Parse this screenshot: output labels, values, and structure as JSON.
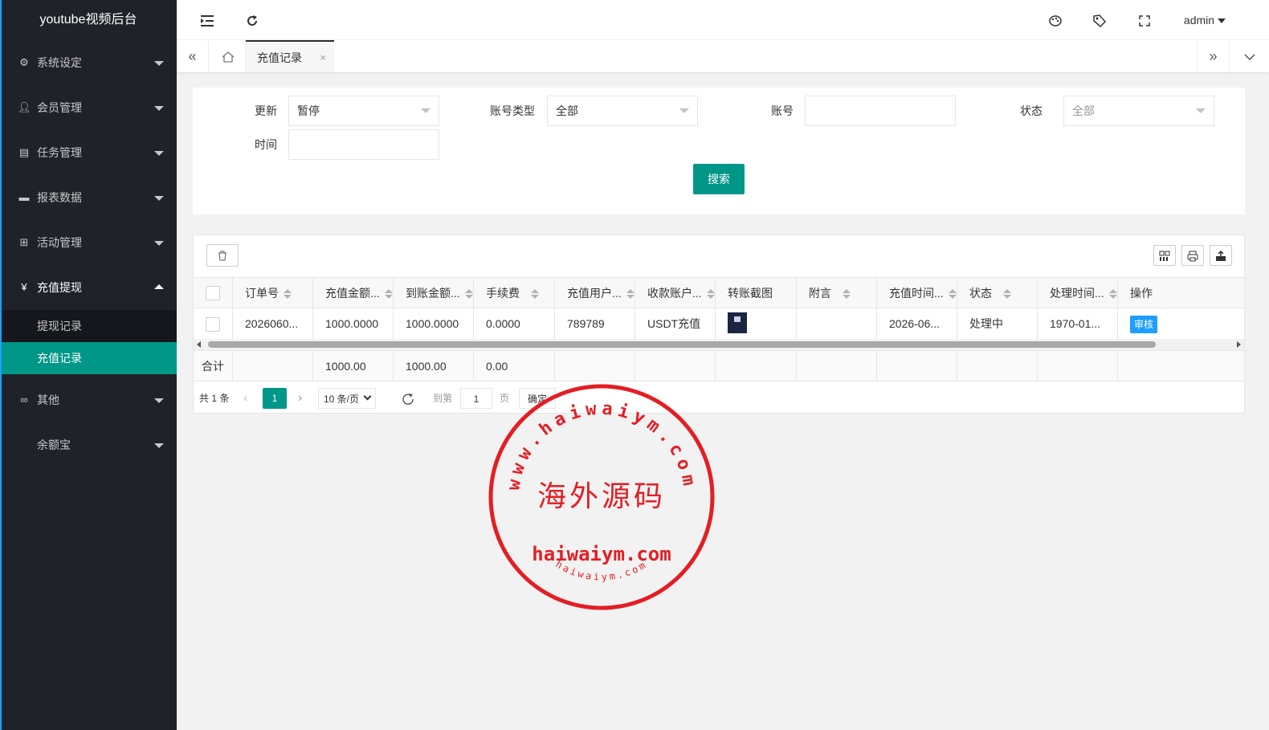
{
  "app": {
    "title": "youtube视频后台"
  },
  "colors": {
    "sidebar_bg": "#20222a",
    "accent": "#009688",
    "info": "#1e9fff",
    "stamp": "#e31e24"
  },
  "sidebar": {
    "items": [
      {
        "label": "系统设定",
        "icon": "gear-icon",
        "open": false
      },
      {
        "label": "会员管理",
        "icon": "user-icon",
        "open": false
      },
      {
        "label": "任务管理",
        "icon": "task-icon",
        "open": false
      },
      {
        "label": "报表数据",
        "icon": "report-icon",
        "open": false
      },
      {
        "label": "活动管理",
        "icon": "activity-icon",
        "open": false
      },
      {
        "label": "充值提现",
        "icon": "yen-icon",
        "open": true,
        "children": [
          {
            "label": "提现记录",
            "active": false
          },
          {
            "label": "充值记录",
            "active": true
          }
        ]
      },
      {
        "label": "其他",
        "icon": "link-icon",
        "open": false
      },
      {
        "label": "余额宝",
        "icon": "",
        "open": false
      }
    ]
  },
  "header": {
    "user": "admin",
    "icons": [
      "menu-fold-icon",
      "refresh-icon",
      "theme-icon",
      "tag-icon",
      "fullscreen-icon"
    ]
  },
  "tabs": {
    "active": "充值记录",
    "close": "×"
  },
  "search": {
    "fields": {
      "update": {
        "label": "更新",
        "value": "暂停"
      },
      "account_type": {
        "label": "账号类型",
        "value": "全部"
      },
      "account": {
        "label": "账号",
        "value": ""
      },
      "status": {
        "label": "状态",
        "placeholder": "全部"
      },
      "time": {
        "label": "时间",
        "value": ""
      }
    },
    "button": "搜索"
  },
  "table": {
    "columns": [
      "订单号",
      "充值金额...",
      "到账金额...",
      "手续费",
      "充值用户...",
      "收款账户...",
      "转账截图",
      "附言",
      "充值时间...",
      "状态",
      "处理时间...",
      "操作"
    ],
    "rows": [
      {
        "order_no": "2026060...",
        "amount": "1000.0000",
        "received": "1000.0000",
        "fee": "0.0000",
        "user": "789789",
        "account": "USDT充值",
        "note": "",
        "time": "2026-06...",
        "status": "处理中",
        "processed": "1970-01...",
        "action": "审核"
      }
    ],
    "total": {
      "label": "合计",
      "amount": "1000.00",
      "received": "1000.00",
      "fee": "0.00"
    }
  },
  "pager": {
    "total": "共 1 条",
    "current": "1",
    "page_size": "10 条/页",
    "goto_label": "到第",
    "goto_value": "1",
    "page_unit": "页",
    "confirm": "确定"
  },
  "stamp": {
    "outer_text": "www.haiwaiym.com",
    "center_text": "海外源码",
    "domain_text": "haiwaiym.com",
    "bottom_text": "haiwaiym.com"
  }
}
